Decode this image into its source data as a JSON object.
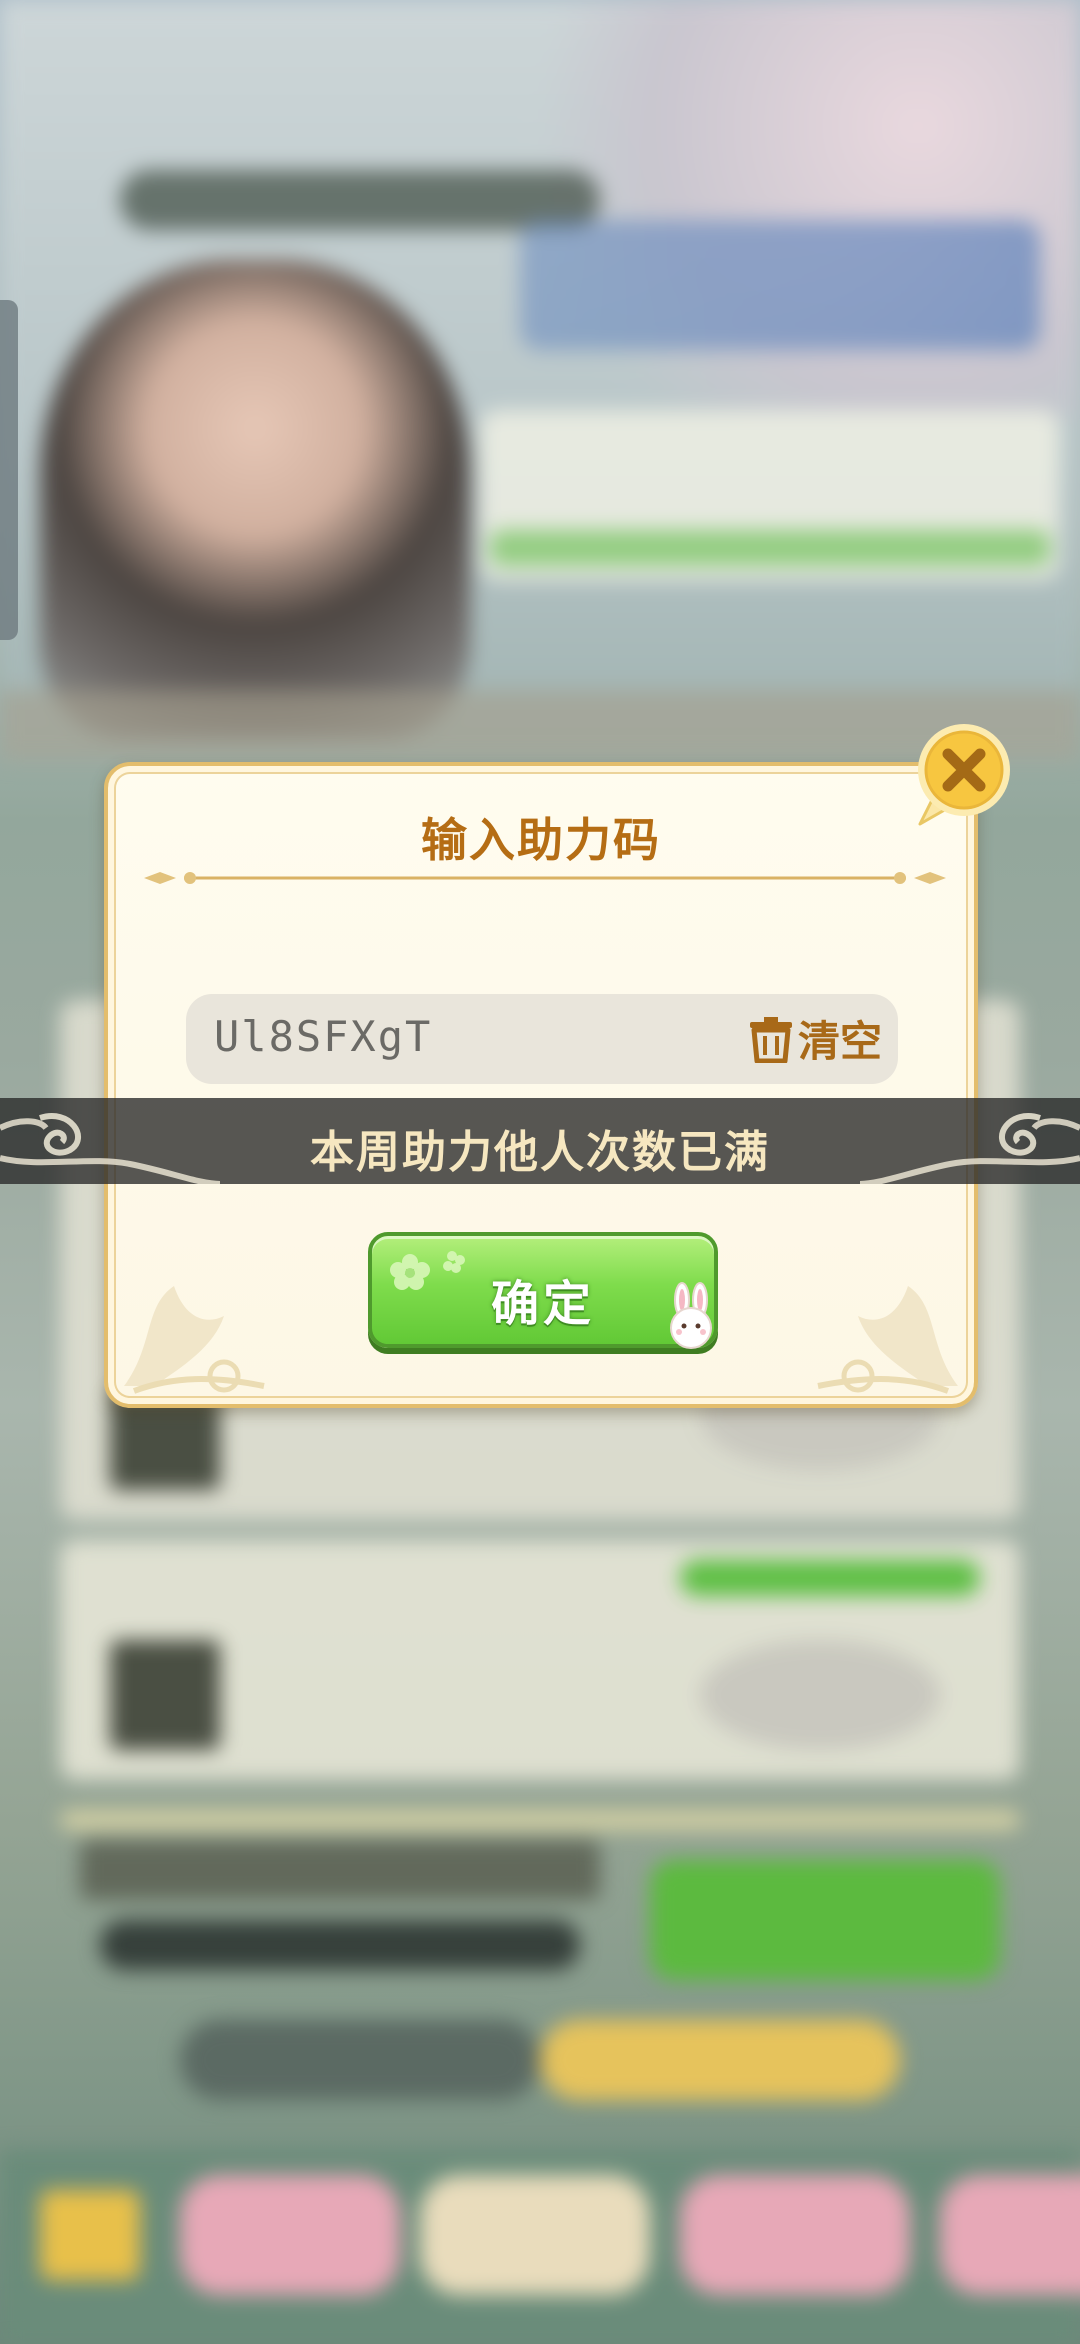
{
  "dialog": {
    "title": "输入助力码",
    "code_input_value": "Ul8SFXgT",
    "clear_label": "清空",
    "confirm_label": "确定"
  },
  "toast": {
    "message": "本周助力他人次数已满"
  },
  "colors": {
    "dialog_title": "#b56d14",
    "dialog_border": "#e3bd6c",
    "confirm_green": "#7fdc4c",
    "close_yellow": "#f7c640",
    "toast_text": "#f6e7c0"
  },
  "icons": {
    "close": "close-x-icon",
    "clear": "trash-icon",
    "mascot": "rabbit-icon"
  }
}
